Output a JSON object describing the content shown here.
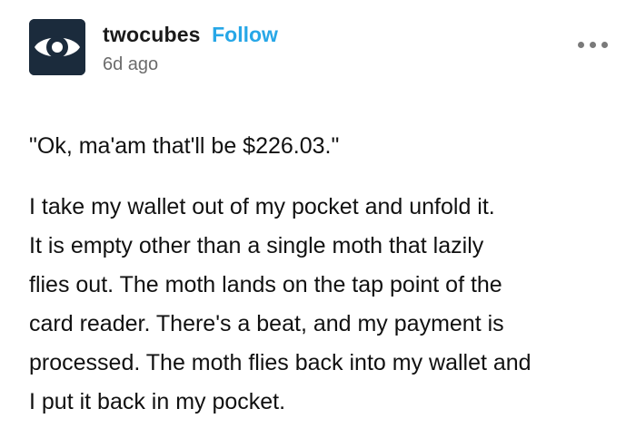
{
  "post": {
    "blog_name": "twocubes",
    "follow_label": "Follow",
    "timestamp": "6d ago",
    "avatar_icon": "eye-icon",
    "more_icon": "more-options-icon",
    "quote": "\"Ok, ma'am that'll be $226.03.\"",
    "paragraph_lines": [
      "I take my wallet out of my pocket and unfold it.",
      "It is empty other than a single moth that lazily",
      "flies out. The moth lands on the tap point of the",
      "card reader. There's a beat, and my payment is",
      "processed. The moth flies back into my wallet and",
      "I put it back in my pocket."
    ]
  },
  "colors": {
    "follow": "#27a7e7",
    "avatar_bg": "#1b2b3c",
    "text": "#111111",
    "muted": "#6b6b6b"
  }
}
